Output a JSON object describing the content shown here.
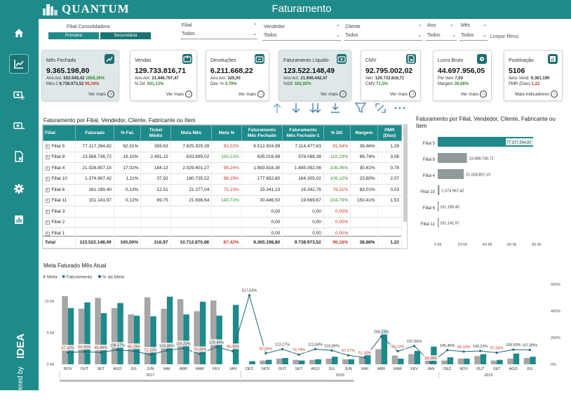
{
  "app": {
    "logo_text": "QUANTUM",
    "title": "Faturamento"
  },
  "sidebar": {
    "powered_by": "Powered by",
    "brand": "IDEA"
  },
  "filters": {
    "filial_consolidadora": {
      "label": "Filial Consolidadora",
      "options": [
        "Primária",
        "Secundária"
      ]
    },
    "filial": {
      "label": "Filial",
      "value": "Todos"
    },
    "vendedor": {
      "label": "Vendedor",
      "value": "Todos"
    },
    "cliente": {
      "label": "Cliente",
      "value": "Todos"
    },
    "ano": {
      "label": "Ano",
      "value": "Todos"
    },
    "mes": {
      "label": "Mês",
      "value": "Todos"
    },
    "clear": "Limpar filtros"
  },
  "kpis": [
    {
      "title": "Mês Fechado",
      "value": "9.365.198,80",
      "line1_label": "Ano Ant.",
      "line1_value": "503.949,42",
      "line1_pct": "1858,36%",
      "line2_label": "Mês-2",
      "line2_value": "9.738.973,52",
      "line2_pct": "96,16%",
      "more": "Ver mais"
    },
    {
      "title": "Vendas",
      "value": "129.733.816,71",
      "line1_label": "Ano Ant.",
      "line1_value": "21.946.767,47",
      "line1_pct": "",
      "line2_label": "% Dif.",
      "line2_value": "",
      "line2_pct": "591,13%",
      "more": "Ver mais"
    },
    {
      "title": "Devoluções",
      "value": "6.211.668,22",
      "line1_label": "Ano Ant.",
      "line1_value": "325,00",
      "line1_pct": "",
      "line2_label": "Dev. %",
      "line2_value": "",
      "line2_pct": "4,79%",
      "more": "Ver mais"
    },
    {
      "title": "Faturamento Líquido",
      "value": "123.522.148,49",
      "line1_label": "Ano Ant.",
      "line1_value": "21.946.442,47",
      "line1_pct": "",
      "line2_label": "%Dif.",
      "line2_value": "",
      "line2_pct": "562,83%",
      "more": "Ver mais"
    },
    {
      "title": "CMV",
      "value": "92.795.002,02",
      "line1_label": "Ven.",
      "line1_value": "129.733.816,71",
      "line1_pct": "",
      "line2_label": "CMV",
      "line2_value": "",
      "line2_pct": "71,5%",
      "more": "Ver mais"
    },
    {
      "title": "Lucro Bruto",
      "value": "44.697.956,05",
      "line1_label": "Por Item",
      "line1_value": "7,03",
      "line1_pct": "",
      "line2_label": "Margem",
      "line2_value": "",
      "line2_pct": "38,68%",
      "more": "Ver mais"
    },
    {
      "title": "Positivação",
      "value": "5106",
      "line1_label": "Itens Vend.",
      "line1_value": "6.361.190",
      "line1_pct": "",
      "line2_label": "PMR (Dias)",
      "line2_value": "",
      "line2_pct": "1,22",
      "more": "Mais indicadores"
    }
  ],
  "table": {
    "title": "Faturamento por Filial, Vendedor, Cliente, Fabricante ou Item",
    "headers": [
      "Filial",
      "Faturado",
      "% Fat.",
      "Ticket Médio",
      "Meta Mês",
      "Meta %",
      "Faturamento Mês Fechado",
      "Faturamento Mês Fechado-1",
      "% Dif.",
      "Margem",
      "PMR (Dias)"
    ],
    "rows": [
      [
        "Filial 5",
        "77.217.264,82",
        "62,51%",
        "359,63",
        "7.825.925,39",
        "83,22%",
        "6.512.924,99",
        "7.114.477,63",
        "91,54%",
        "39,46%",
        "1,29"
      ],
      [
        "Filial 8",
        "23.588.736,72",
        "19,10%",
        "2.491,15",
        "633.695,02",
        "100,21%",
        "635.016,98",
        "576.086,38",
        "110,23%",
        "89,74%",
        "3,06"
      ],
      [
        "Filial 4",
        "21.028.857,15",
        "17,02%",
        "184,13",
        "2.029.601,27",
        "98,24%",
        "1.993.816,30",
        "1.845.092,06",
        "108,06%",
        "30,61%",
        "0,78"
      ],
      [
        "Filial 10",
        "1.374.967,42",
        "1,11%",
        "37,92",
        "180.735,52",
        "98,29%",
        "177.652,80",
        "164.305,02",
        "108,12%",
        "23,80%",
        "2,07"
      ],
      [
        "Filial 6",
        "161.180,40",
        "0,13%",
        "12,51",
        "21.277,04",
        "72,10%",
        "15.341,23",
        "19.342,76",
        "79,31%",
        "83,01%",
        "0,03"
      ],
      [
        "Filial 11",
        "151.141,97",
        "0,12%",
        "69,75",
        "21.636,64",
        "140,72%",
        "30.446,50",
        "19.669,67",
        "154,79%",
        "150,41%",
        "1,53"
      ],
      [
        "Filial 3",
        "",
        "",
        "",
        "",
        "",
        "0,00",
        "0,00",
        "0,00%",
        "",
        ""
      ],
      [
        "Filial 2",
        "",
        "",
        "",
        "",
        "",
        "0,00",
        "0,00",
        "0,00%",
        "",
        ""
      ],
      [
        "Filial 1",
        "",
        "",
        "",
        "",
        "",
        "0,00",
        "0,00",
        "0,00%",
        "",
        ""
      ]
    ],
    "pct_colors": [
      [
        "",
        "cr",
        "",
        "cr"
      ],
      [
        "",
        "cg",
        "",
        "cg"
      ],
      [
        "",
        "cr",
        "",
        "cg"
      ],
      [
        "",
        "cr",
        "",
        "cg"
      ],
      [
        "",
        "cr",
        "",
        "cr"
      ],
      [
        "",
        "cg",
        "",
        "cg"
      ],
      [
        "",
        "",
        "",
        "cr"
      ],
      [
        "",
        "",
        "",
        "cr"
      ],
      [
        "",
        "",
        "",
        "cr"
      ]
    ],
    "total": [
      "Total",
      "123.522.148,49",
      "100,00%",
      "316,97",
      "10.712.870,88",
      "87,42%",
      "9.365.198,80",
      "9.738.973,52",
      "96,16%",
      "38,68%",
      "1,22"
    ]
  },
  "chart_data": [
    {
      "type": "bar",
      "title": "Faturamento por Filial, Vendedor, Cliente, Fabricante ou Item",
      "orientation": "horizontal",
      "categories": [
        "Filial 5",
        "Filial 8",
        "Filial 4",
        "Filial 10",
        "Filial 6",
        "Filial 11"
      ],
      "values": [
        77217264.82,
        23588736.72,
        21028857.15,
        1374967.42,
        161180.4,
        151141.97
      ],
      "data_labels": [
        "77.217.264,82",
        "23.588.736,72",
        "21.028.857,15",
        "1.374.967,42",
        "161.180,40",
        "151.141,97"
      ],
      "x_ticks": [
        "0 Mi",
        "20 Mi",
        "40 Mi",
        "60 Mi",
        "80 Mi"
      ],
      "xlim": [
        0,
        80000000
      ],
      "colors": {
        "highlight": "#1f8a8a",
        "other": "#8f9a9a"
      }
    },
    {
      "type": "bar",
      "title": "Meta Faturado Mês Atual",
      "legend": [
        "Meta",
        "Faturamento",
        "% da Meta"
      ],
      "legend_position": "top-left",
      "colors": {
        "Meta": "#a6a6a6",
        "Faturamento": "#1f8a8a",
        "% da Meta": "#1b6a75"
      },
      "categories": [
        "NOV",
        "OUT",
        "SET",
        "AGO",
        "JUL",
        "JUN",
        "MAI",
        "ABR",
        "MAR",
        "FEV",
        "JAN",
        "DEZ",
        "NOV",
        "OUT",
        "SET",
        "AGO",
        "JUL",
        "JUN",
        "MAI",
        "ABR",
        "MAR",
        "FEV",
        "JAN",
        "DEZ",
        "NOV",
        "OUT",
        "SET",
        "AGO",
        "JUL"
      ],
      "year_groups": [
        {
          "label": "2017",
          "start": 0,
          "end": 10
        },
        {
          "label": "2016",
          "start": 11,
          "end": 22
        },
        {
          "label": "2015",
          "start": 23,
          "end": 28
        }
      ],
      "y_ticks_left": [
        "0 Mi",
        "5 Mi",
        "10 Mi"
      ],
      "ylim_left": [
        0,
        12000000
      ],
      "y_ticks_right": [
        "0%",
        "200%",
        "400%",
        "600%"
      ],
      "ylim_right": [
        0,
        600
      ],
      "series": [
        {
          "name": "Meta",
          "values": [
            10.8,
            8.8,
            10.5,
            8.9,
            7.9,
            10.6,
            8.8,
            10.3,
            8.4,
            10.1,
            0,
            0,
            0.6,
            0.9,
            0.7,
            0.7,
            0.9,
            0.8,
            1.1,
            2.4,
            1.4,
            1.6,
            1.3,
            0.6,
            0.9,
            1.3,
            0.6,
            0.9,
            1.0
          ]
        },
        {
          "name": "Faturamento",
          "values": [
            8.9,
            9.8,
            8.1,
            9.7,
            7.7,
            7.6,
            10.7,
            7.9,
            9.9,
            7.7,
            9.4,
            0.5,
            0.7,
            1.0,
            0.6,
            0.8,
            1.2,
            0.8,
            1.6,
            5.6,
            0.9,
            2.1,
            2.8,
            1.1,
            0.9,
            1.6,
            0.7,
            1.7,
            1.2
          ]
        },
        {
          "name": "% da Meta",
          "values": [
            87.42,
            94.5,
            88.88,
            108.57,
            98.29,
            72.1,
            103.86,
            119.22,
            76.09,
            129.43,
            98.08,
            517.53,
            82.36,
            113.17,
            72.74,
            113.94,
            103.8,
            67.17,
            51.3,
            208.23,
            98.13,
            137.66,
            10.09,
            106.46,
            95.1,
            100.23,
            87.04,
            109.93,
            107.89
          ],
          "labels": [
            "87,42%",
            "94,50%",
            "88,88%",
            "108,57%",
            "98,29%",
            "72,10%",
            "103,86%",
            "119,22%",
            "76,09%",
            "129,43%",
            "98,08%",
            "517,53%",
            "82,36%",
            "113,17%",
            "72,74%",
            "113,94%",
            "103,80%",
            "67,17%",
            "51,30%",
            "208,23%",
            "98,13%",
            "137,66%",
            "10,09%",
            "106,46%",
            "95,10%",
            "100,23%",
            "87,04%",
            "109,93%",
            "107,89%"
          ]
        }
      ]
    }
  ]
}
